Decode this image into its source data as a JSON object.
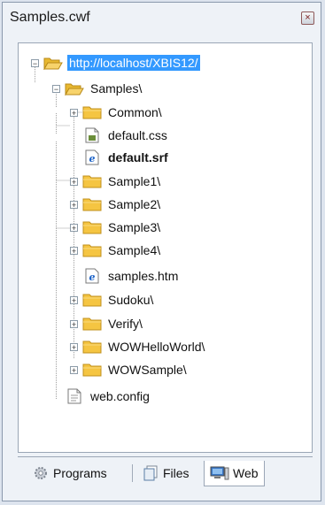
{
  "window": {
    "title": "Samples.cwf",
    "close_glyph": "×"
  },
  "tree": {
    "nodes": [
      {
        "label": "http://localhost/XBIS12/",
        "icon": "folder-open-icon",
        "expander": "−",
        "selected": true
      },
      {
        "label": "Samples\\",
        "icon": "folder-open-icon",
        "expander": "−"
      },
      {
        "label": "Common\\",
        "icon": "folder-icon",
        "expander": "+"
      },
      {
        "label": "default.css",
        "icon": "css-file-icon"
      },
      {
        "label": "default.srf",
        "icon": "ie-file-icon",
        "bold": true
      },
      {
        "label": "Sample1\\",
        "icon": "folder-icon",
        "expander": "+"
      },
      {
        "label": "Sample2\\",
        "icon": "folder-icon",
        "expander": "+"
      },
      {
        "label": "Sample3\\",
        "icon": "folder-icon",
        "expander": "+"
      },
      {
        "label": "Sample4\\",
        "icon": "folder-icon",
        "expander": "+"
      },
      {
        "label": "samples.htm",
        "icon": "ie-file-icon"
      },
      {
        "label": "Sudoku\\",
        "icon": "folder-icon",
        "expander": "+"
      },
      {
        "label": "Verify\\",
        "icon": "folder-icon",
        "expander": "+"
      },
      {
        "label": "WOWHelloWorld\\",
        "icon": "folder-icon",
        "expander": "+"
      },
      {
        "label": "WOWSample\\",
        "icon": "folder-icon",
        "expander": "+"
      },
      {
        "label": "web.config",
        "icon": "config-file-icon"
      }
    ]
  },
  "tabs": [
    {
      "label": "Programs",
      "icon": "gear-icon"
    },
    {
      "label": "Files",
      "icon": "files-icon"
    },
    {
      "label": "Web",
      "icon": "web-icon",
      "active": true
    }
  ],
  "colors": {
    "selection": "#3399ff",
    "folder": "#f5c542"
  }
}
